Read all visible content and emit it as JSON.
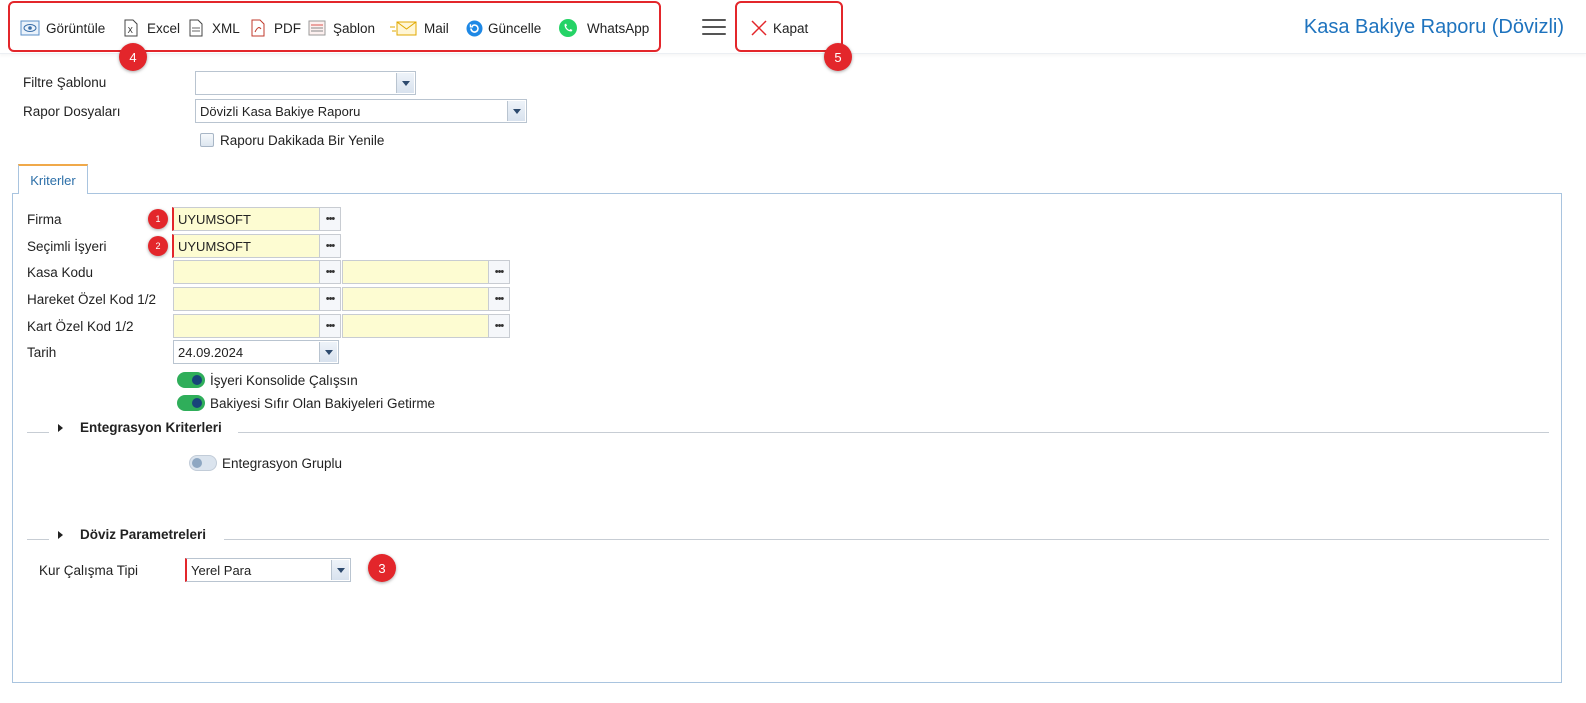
{
  "toolbar": {
    "view_label": "Görüntüle",
    "excel_label": "Excel",
    "xml_label": "XML",
    "pdf_label": "PDF",
    "template_label": "Şablon",
    "mail_label": "Mail",
    "refresh_label": "Güncelle",
    "whatsapp_label": "WhatsApp",
    "close_label": "Kapat"
  },
  "page_title": "Kasa Bakiye Raporu (Dövizli)",
  "filter": {
    "template_label": "Filtre Şablonu",
    "template_value": "",
    "report_files_label": "Rapor Dosyaları",
    "report_files_value": "Dövizli Kasa Bakiye Raporu",
    "refresh_minute_label": "Raporu Dakikada Bir Yenile"
  },
  "tab_label": "Kriterler",
  "criteria": {
    "firm_label": "Firma",
    "firm_value": "UYUMSOFT",
    "branch_label": "Seçimli İşyeri",
    "branch_value": "UYUMSOFT",
    "cash_code_label": "Kasa Kodu",
    "movement_code_label": "Hareket Özel Kod 1/2",
    "card_code_label": "Kart Özel Kod 1/2",
    "date_label": "Tarih",
    "date_value": "24.09.2024",
    "consolidate_label": "İşyeri Konsolide Çalışsın",
    "zero_balance_label": "Bakiyesi Sıfır Olan Bakiyeleri Getirme"
  },
  "integration": {
    "section_title": "Entegrasyon Kriterleri",
    "group_label": "Entegrasyon Gruplu"
  },
  "currency": {
    "section_title": "Döviz Parametreleri",
    "rate_type_label": "Kur Çalışma Tipi",
    "rate_type_value": "Yerel Para"
  },
  "badges": {
    "b1": "1",
    "b2": "2",
    "b3": "3",
    "b4": "4",
    "b5": "5"
  },
  "colors": {
    "accent": "#1e73be",
    "highlight": "#e3262b",
    "toggle_on": "#2fae5a",
    "field_bg": "#fdfcd2"
  }
}
